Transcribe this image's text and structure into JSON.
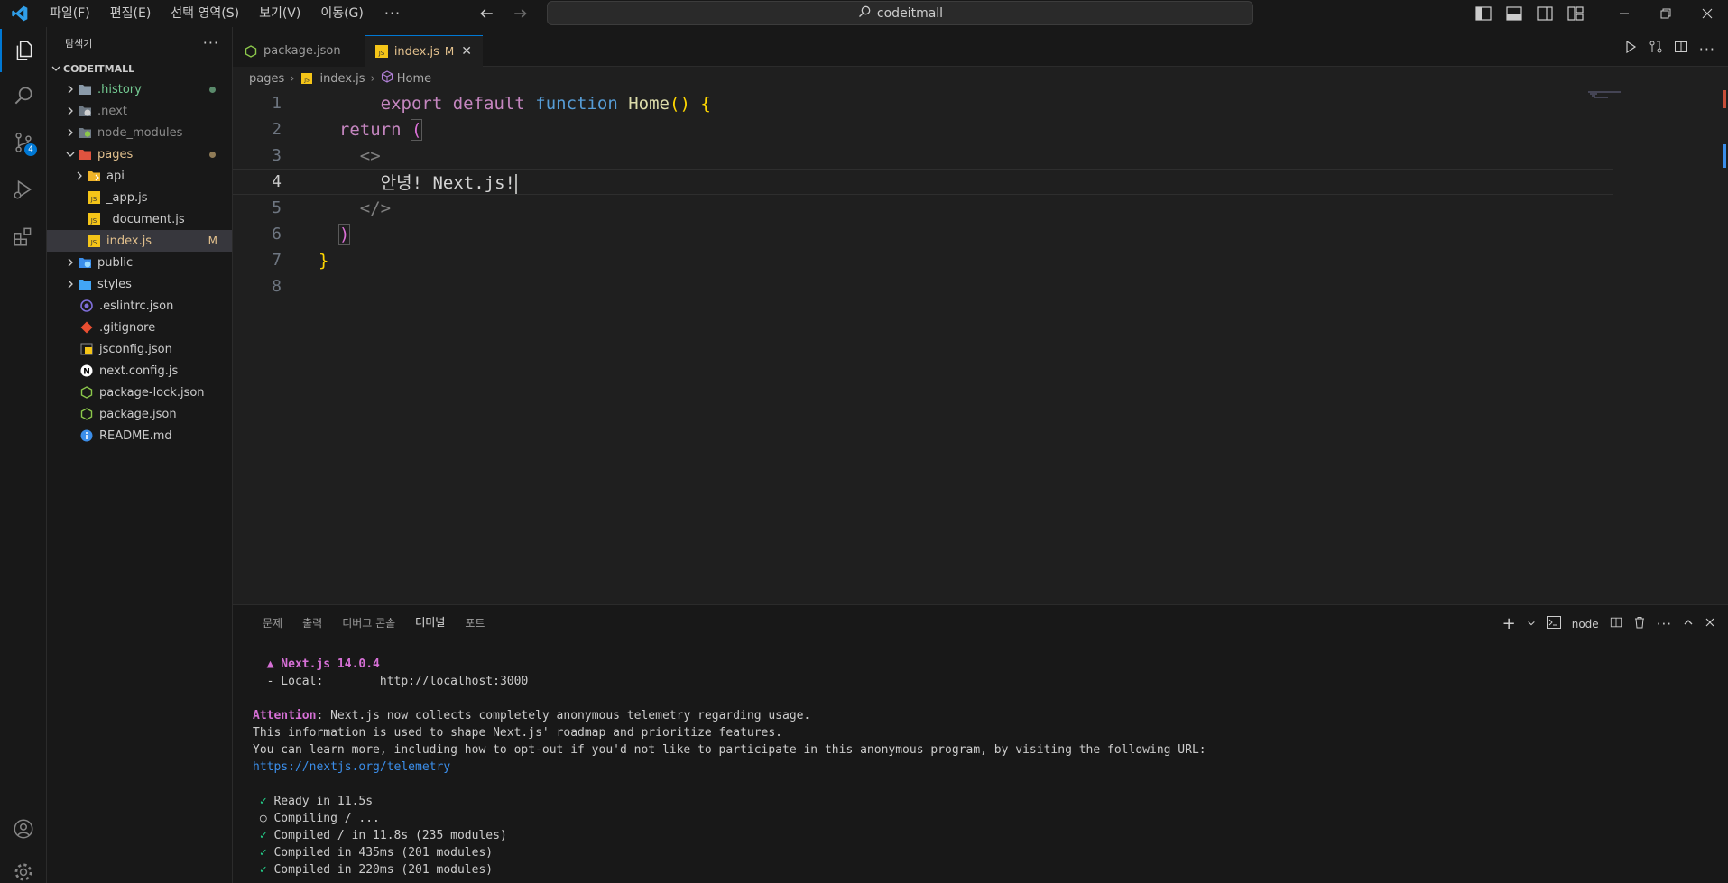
{
  "titlebar": {
    "menus": [
      "파일(F)",
      "편집(E)",
      "선택 영역(S)",
      "보기(V)",
      "이동(G)"
    ],
    "more": "···",
    "search": "codeitmall"
  },
  "activity": {
    "scm_badge": "4"
  },
  "sidebar": {
    "title": "탐색기",
    "more": "···",
    "root": "CODEITMALL",
    "items": [
      {
        "label": ".history",
        "type": "folder",
        "color": "#73c991"
      },
      {
        "label": ".next",
        "type": "folder"
      },
      {
        "label": "node_modules",
        "type": "folder"
      },
      {
        "label": "pages",
        "type": "folder",
        "color": "#e2c08d"
      },
      {
        "label": "api",
        "type": "folder"
      },
      {
        "label": "_app.js",
        "type": "js"
      },
      {
        "label": "_document.js",
        "type": "js"
      },
      {
        "label": "index.js",
        "type": "js",
        "color": "#e2c08d",
        "status": "M"
      },
      {
        "label": "public",
        "type": "folder"
      },
      {
        "label": "styles",
        "type": "folder"
      },
      {
        "label": ".eslintrc.json",
        "type": "eslint"
      },
      {
        "label": ".gitignore",
        "type": "git"
      },
      {
        "label": "jsconfig.json",
        "type": "json"
      },
      {
        "label": "next.config.js",
        "type": "next"
      },
      {
        "label": "package-lock.json",
        "type": "node"
      },
      {
        "label": "package.json",
        "type": "node"
      },
      {
        "label": "README.md",
        "type": "info"
      }
    ]
  },
  "tabs": [
    {
      "label": "package.json",
      "active": false
    },
    {
      "label": "index.js",
      "active": true,
      "status": "M",
      "close": "✕"
    }
  ],
  "breadcrumb": [
    "pages",
    "index.js",
    "Home"
  ],
  "editor": {
    "line_numbers": [
      "1",
      "2",
      "3",
      "4",
      "5",
      "6",
      "7",
      "8"
    ],
    "tokens": {
      "export": "export",
      "default": "default",
      "function": "function",
      "home": "Home",
      "parens": "()",
      "brace_open": "{",
      "return": "return",
      "paren_open": "(",
      "frag_open": "<>",
      "text": "안녕! Next.js!",
      "frag_close": "</>",
      "paren_close": ")",
      "brace_close": "}"
    }
  },
  "panel": {
    "tabs": [
      "문제",
      "출력",
      "디버그 콘솔",
      "터미널",
      "포트"
    ],
    "active_tab": "터미널",
    "terminal_name": "node",
    "terminal": {
      "l1": "▲ Next.js 14.0.4",
      "l2_key": "- Local:",
      "l2_val": "http://localhost:3000",
      "l3_attn": "Attention",
      "l3_rest": ": Next.js now collects completely anonymous telemetry regarding usage.",
      "l4": "This information is used to shape Next.js' roadmap and prioritize features.",
      "l5": "You can learn more, including how to opt-out if you'd not like to participate in this anonymous program, by visiting the following URL:",
      "l6": "https://nextjs.org/telemetry",
      "l7": "Ready in 11.5s",
      "l8": "Compiling / ...",
      "l9": "Compiled / in 11.8s (235 modules)",
      "l10": "Compiled in 435ms (201 modules)",
      "l11": "Compiled in 220ms (201 modules)",
      "check": "✓",
      "circle": "○"
    }
  }
}
